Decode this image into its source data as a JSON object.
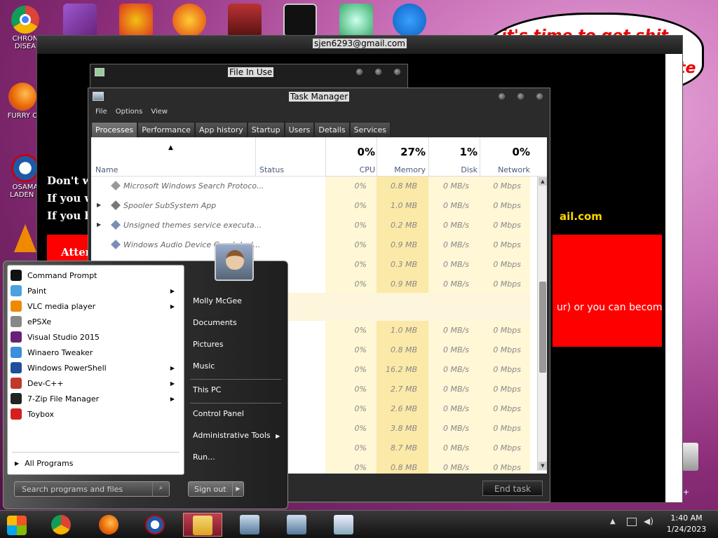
{
  "desktop": {
    "icons": [
      {
        "label": "CHRON\nDISEA",
        "icon": "chrome-icon",
        "color": "#2a8f3b"
      },
      {
        "label": "FURRY C",
        "icon": "firefox-icon",
        "color": "#e76a1c"
      },
      {
        "label": "OSAMA\nLADEN E",
        "icon": "obama-logo-icon",
        "color": "#1f58a8"
      },
      {
        "label": "",
        "icon": "vlc-icon",
        "color": "#ef8a00"
      }
    ],
    "speech_text": "it's time to get shit",
    "speech_tail": "te"
  },
  "ransom": {
    "title": "sjen6293@gmail.com",
    "line1": "Don't wo",
    "line2": "If you w",
    "line3": "If you ha",
    "email_tail": "ail.com",
    "attn": "Atten",
    "red_text": "ur) or you can become",
    "cpp": "n C++"
  },
  "file_in_use": {
    "title": "File In Use"
  },
  "task_manager": {
    "title": "Task Manager",
    "menu": [
      "File",
      "Options",
      "View"
    ],
    "tabs": [
      "Processes",
      "Performance",
      "App history",
      "Startup",
      "Users",
      "Details",
      "Services"
    ],
    "active_tab": 0,
    "headers": {
      "name": "Name",
      "status": "Status",
      "cpu_pct": "0%",
      "cpu": "CPU",
      "mem_pct": "27%",
      "mem": "Memory",
      "disk_pct": "1%",
      "disk": "Disk",
      "net_pct": "0%",
      "net": "Network"
    },
    "rows": [
      {
        "name": "Microsoft Windows Search Protoco...",
        "cpu": "0%",
        "mem": "0.8 MB",
        "disk": "0 MB/s",
        "net": "0 Mbps",
        "expand": ""
      },
      {
        "name": "Spooler SubSystem App",
        "cpu": "0%",
        "mem": "1.0 MB",
        "disk": "0 MB/s",
        "net": "0 Mbps",
        "expand": "▶"
      },
      {
        "name": "Unsigned themes service executa...",
        "cpu": "0%",
        "mem": "0.2 MB",
        "disk": "0 MB/s",
        "net": "0 Mbps",
        "expand": "▶"
      },
      {
        "name": "Windows Audio Device Graph Isol...",
        "cpu": "0%",
        "mem": "0.9 MB",
        "disk": "0 MB/s",
        "net": "0 Mbps",
        "expand": ""
      },
      {
        "name": "",
        "cpu": "0%",
        "mem": "0.3 MB",
        "disk": "0 MB/s",
        "net": "0 Mbps",
        "expand": ""
      },
      {
        "name": "",
        "cpu": "0%",
        "mem": "0.9 MB",
        "disk": "0 MB/s",
        "net": "0 Mbps",
        "expand": ""
      },
      {
        "name": "",
        "cpu": "0%",
        "mem": "1.0 MB",
        "disk": "0 MB/s",
        "net": "0 Mbps",
        "expand": ""
      },
      {
        "name": "",
        "cpu": "0%",
        "mem": "0.8 MB",
        "disk": "0 MB/s",
        "net": "0 Mbps",
        "expand": ""
      },
      {
        "name": "",
        "cpu": "0%",
        "mem": "16.2 MB",
        "disk": "0 MB/s",
        "net": "0 Mbps",
        "expand": ""
      },
      {
        "name": "",
        "cpu": "0%",
        "mem": "2.7 MB",
        "disk": "0 MB/s",
        "net": "0 Mbps",
        "expand": ""
      },
      {
        "name": "",
        "cpu": "0%",
        "mem": "2.6 MB",
        "disk": "0 MB/s",
        "net": "0 Mbps",
        "expand": ""
      },
      {
        "name": "",
        "cpu": "0%",
        "mem": "3.8 MB",
        "disk": "0 MB/s",
        "net": "0 Mbps",
        "expand": ""
      },
      {
        "name": "",
        "cpu": "0%",
        "mem": "8.7 MB",
        "disk": "0 MB/s",
        "net": "0 Mbps",
        "expand": ""
      },
      {
        "name": "",
        "cpu": "0%",
        "mem": "0.8 MB",
        "disk": "0 MB/s",
        "net": "0 Mbps",
        "expand": ""
      }
    ],
    "end_task": "End task"
  },
  "start_menu": {
    "programs": [
      {
        "label": "Command Prompt",
        "icon": "command-prompt-icon",
        "submenu": false
      },
      {
        "label": "Paint",
        "icon": "paint-icon",
        "submenu": true
      },
      {
        "label": "VLC media player",
        "icon": "vlc-icon",
        "submenu": true
      },
      {
        "label": "ePSXe",
        "icon": "gamepad-icon",
        "submenu": false
      },
      {
        "label": "Visual Studio 2015",
        "icon": "visual-studio-icon",
        "submenu": false
      },
      {
        "label": "Winaero Tweaker",
        "icon": "winaero-icon",
        "submenu": false
      },
      {
        "label": "Windows PowerShell",
        "icon": "powershell-icon",
        "submenu": true
      },
      {
        "label": "Dev-C++",
        "icon": "devcpp-icon",
        "submenu": true
      },
      {
        "label": "7-Zip File Manager",
        "icon": "7zip-icon",
        "submenu": true
      },
      {
        "label": "Toybox",
        "icon": "toybox-icon",
        "submenu": false
      }
    ],
    "all_programs": "All Programs",
    "search_placeholder": "Search programs and files",
    "right_items": [
      {
        "label": "Molly McGee",
        "submenu": false
      },
      {
        "label": "Documents",
        "submenu": false
      },
      {
        "label": "Pictures",
        "submenu": false
      },
      {
        "label": "Music",
        "submenu": false
      },
      {
        "label": "This PC",
        "submenu": false
      },
      {
        "label": "Control Panel",
        "submenu": false
      },
      {
        "label": "Administrative Tools",
        "submenu": true
      },
      {
        "label": "Run...",
        "submenu": false
      }
    ],
    "sign_out": "Sign out"
  },
  "taskbar": {
    "time": "1:40 AM",
    "date": "1/24/2023"
  }
}
